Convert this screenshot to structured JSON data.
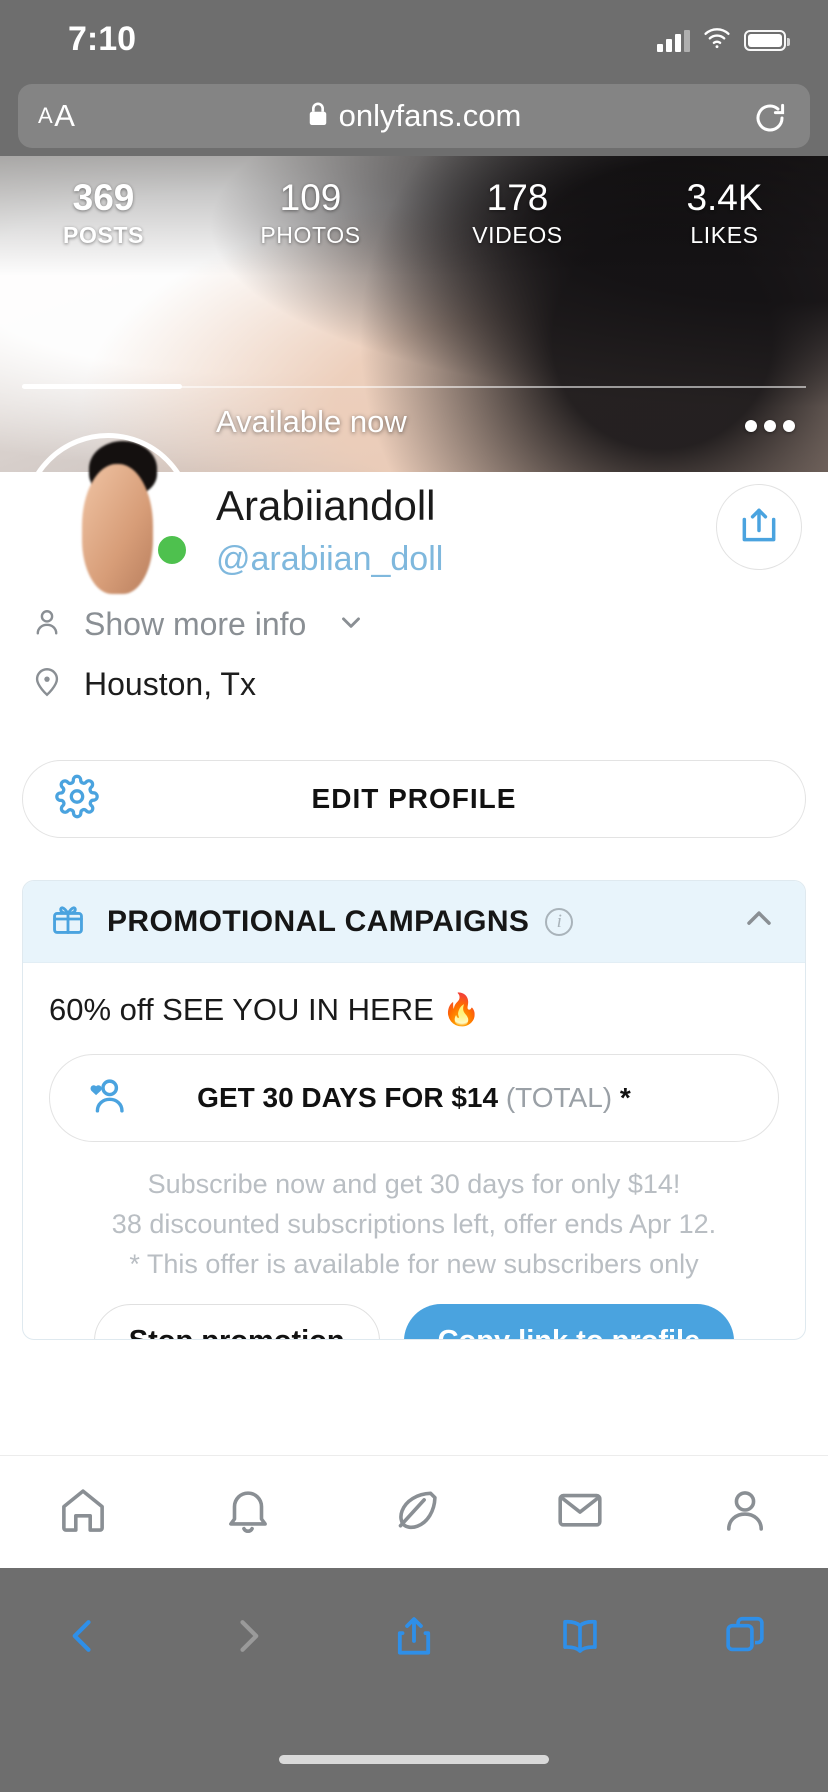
{
  "browser": {
    "status": {
      "time": "7:10",
      "signal_icon": "cellular-signal-icon",
      "wifi_icon": "wifi-icon",
      "battery_icon": "battery-icon"
    },
    "address_bar": {
      "text_size_label_small": "A",
      "text_size_label_big": "A",
      "lock_icon": "lock-icon",
      "url": "onlyfans.com",
      "reload_icon": "reload-icon"
    },
    "toolbar": {
      "back_icon": "back-chevron-icon",
      "forward_icon": "forward-chevron-icon",
      "share_icon": "share-icon",
      "bookmarks_icon": "book-icon",
      "tabs_icon": "tabs-icon"
    }
  },
  "profile": {
    "stats": [
      {
        "value": "369",
        "label": "POSTS",
        "active": true
      },
      {
        "value": "109",
        "label": "PHOTOS",
        "active": false
      },
      {
        "value": "178",
        "label": "VIDEOS",
        "active": false
      },
      {
        "value": "3.4K",
        "label": "LIKES",
        "active": false
      }
    ],
    "availability": "Available now",
    "more_menu_icon": "more-options-icon",
    "avatar_icon": "avatar",
    "online_indicator": "online-status-dot",
    "display_name": "Arabiiandoll",
    "handle": "@arabiian_doll",
    "share_button_icon": "share-profile-icon",
    "show_more_info": "Show more info",
    "location": "Houston, Tx",
    "edit_profile": "EDIT PROFILE",
    "edit_profile_icon": "gear-icon"
  },
  "promo": {
    "header_title": "PROMOTIONAL CAMPAIGNS",
    "header_icon": "gift-icon",
    "info_icon": "info-icon",
    "collapse_icon": "chevron-up-icon",
    "description": "60% off SEE YOU IN HERE 🔥",
    "cta_icon": "subscriber-heart-icon",
    "cta_main": "GET 30 DAYS FOR $14",
    "cta_total": "(TOTAL)",
    "cta_star": "*",
    "fineprint_line1": "Subscribe now and get 30 days for only $14!",
    "fineprint_line2": "38 discounted subscriptions left, offer ends Apr 12.",
    "fineprint_line3": "* This offer is available for new subscribers only",
    "stop_button": "Stop promotion",
    "copy_button": "Copy link to profile"
  },
  "appnav": {
    "items": [
      {
        "icon": "home-icon"
      },
      {
        "icon": "bell-icon"
      },
      {
        "icon": "feather-icon"
      },
      {
        "icon": "envelope-icon"
      },
      {
        "icon": "profile-icon"
      }
    ]
  },
  "colors": {
    "accent_blue": "#4aa3df",
    "handle_blue": "#7fb8dd",
    "promo_header_bg": "#e8f4fb",
    "online_green": "#4ec14e",
    "chrome_gray": "#6e6e6e"
  }
}
